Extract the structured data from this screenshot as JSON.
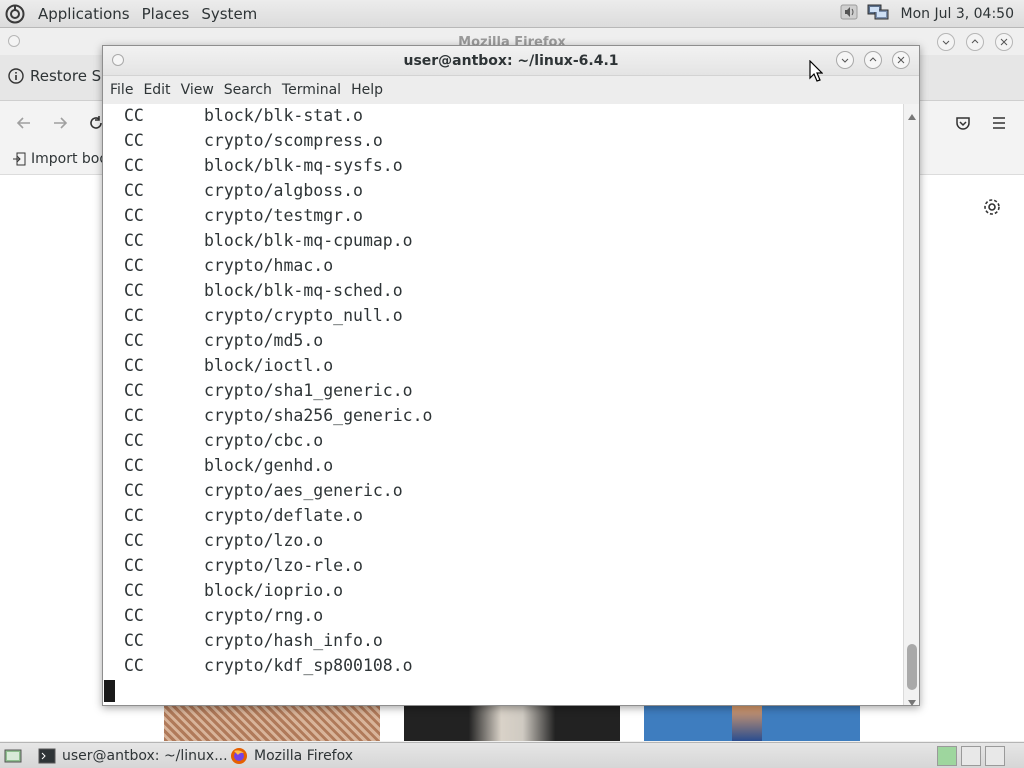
{
  "top_panel": {
    "menus": [
      "Applications",
      "Places",
      "System"
    ],
    "clock": "Mon Jul 3, 04:50"
  },
  "firefox": {
    "title": "Mozilla Firefox",
    "restore_label": "Restore Se",
    "import_label": "Import boo"
  },
  "terminal": {
    "title": "user@antbox: ~/linux-6.4.1",
    "menu": [
      "File",
      "Edit",
      "View",
      "Search",
      "Terminal",
      "Help"
    ],
    "lines": [
      {
        "cmd": "CC",
        "path": "block/blk-stat.o"
      },
      {
        "cmd": "CC",
        "path": "crypto/scompress.o"
      },
      {
        "cmd": "CC",
        "path": "block/blk-mq-sysfs.o"
      },
      {
        "cmd": "CC",
        "path": "crypto/algboss.o"
      },
      {
        "cmd": "CC",
        "path": "crypto/testmgr.o"
      },
      {
        "cmd": "CC",
        "path": "block/blk-mq-cpumap.o"
      },
      {
        "cmd": "CC",
        "path": "crypto/hmac.o"
      },
      {
        "cmd": "CC",
        "path": "block/blk-mq-sched.o"
      },
      {
        "cmd": "CC",
        "path": "crypto/crypto_null.o"
      },
      {
        "cmd": "CC",
        "path": "crypto/md5.o"
      },
      {
        "cmd": "CC",
        "path": "block/ioctl.o"
      },
      {
        "cmd": "CC",
        "path": "crypto/sha1_generic.o"
      },
      {
        "cmd": "CC",
        "path": "crypto/sha256_generic.o"
      },
      {
        "cmd": "CC",
        "path": "crypto/cbc.o"
      },
      {
        "cmd": "CC",
        "path": "block/genhd.o"
      },
      {
        "cmd": "CC",
        "path": "crypto/aes_generic.o"
      },
      {
        "cmd": "CC",
        "path": "crypto/deflate.o"
      },
      {
        "cmd": "CC",
        "path": "crypto/lzo.o"
      },
      {
        "cmd": "CC",
        "path": "crypto/lzo-rle.o"
      },
      {
        "cmd": "CC",
        "path": "block/ioprio.o"
      },
      {
        "cmd": "CC",
        "path": "crypto/rng.o"
      },
      {
        "cmd": "CC",
        "path": "crypto/hash_info.o"
      },
      {
        "cmd": "CC",
        "path": "crypto/kdf_sp800108.o"
      }
    ]
  },
  "taskbar": {
    "tasks": [
      {
        "label": "user@antbox: ~/linux...",
        "icon": "terminal-icon"
      },
      {
        "label": "Mozilla Firefox",
        "icon": "firefox-icon"
      }
    ]
  },
  "colors": {
    "panel": "#e2e2e2",
    "terminal_bg": "#ffffff",
    "terminal_text": "#2e3436"
  }
}
